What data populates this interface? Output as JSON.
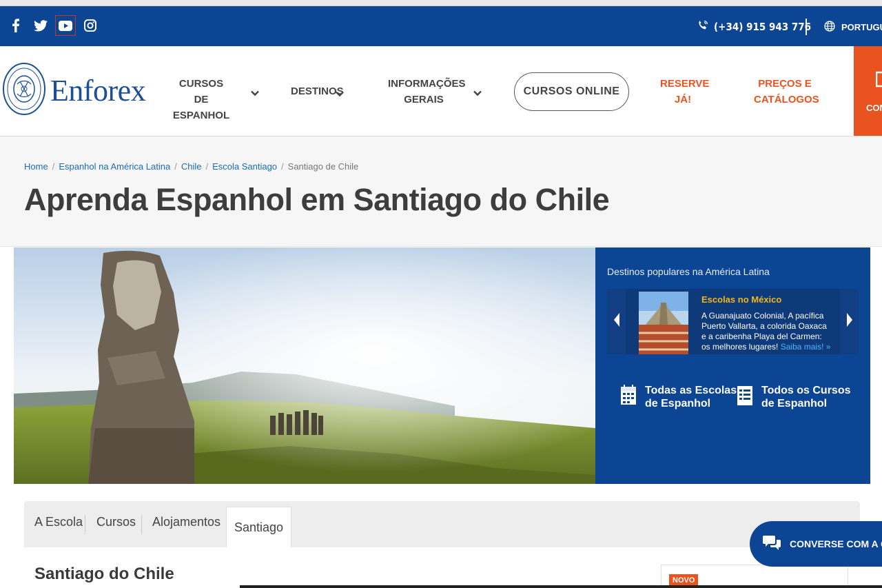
{
  "topbar": {
    "phone": "(+34) 915 943 776",
    "language": "PORTUGU",
    "social": [
      "facebook-icon",
      "twitter-icon",
      "youtube-icon",
      "instagram-icon"
    ]
  },
  "header": {
    "logo_text": "Enforex",
    "nav": {
      "cursos_line1": "CURSOS DE",
      "cursos_line2": "ESPANHOL",
      "destinos": "DESTINOS",
      "info_line1": "INFORMAÇÕES",
      "info_line2": "GERAIS",
      "online": "CURSOS ONLINE",
      "reserve_line1": "RESERVE",
      "reserve_line2": "JÁ!",
      "precos_line1": "PREÇOS E",
      "precos_line2": "CATÁLOGOS",
      "contact_short": "CON"
    }
  },
  "breadcrumb": {
    "items": [
      "Home",
      "Espanhol na América Latina",
      "Chile",
      "Escola Santiago"
    ],
    "current": "Santiago de Chile"
  },
  "page_title": "Aprenda Espanhol em Santiago do Chile",
  "promo": {
    "label": "Destinos populares na América Latina",
    "card_title": "Escolas no México",
    "card_text": "A Guanajuato Colonial, A pacífica Puerto Vallarta, a colorida Oaxaca e a caribenha Playa del Carmen: os melhores lugares!",
    "card_link": "Saiba mais! »",
    "link1_line1": "Todas as Escolas",
    "link1_line2": "de Espanhol",
    "link2_line1": "Todos os Cursos",
    "link2_line2": "de Espanhol"
  },
  "tabs": [
    "A Escola",
    "Cursos",
    "Alojamentos",
    "Santiago"
  ],
  "section_title": "Santiago do Chile",
  "badge": "NOVO",
  "chat_label": "CONVERSE COM A GEN",
  "colors": {
    "brand_blue": "#0d4595",
    "accent_orange": "#e8531f",
    "highlight_yellow": "#f2b51b"
  }
}
